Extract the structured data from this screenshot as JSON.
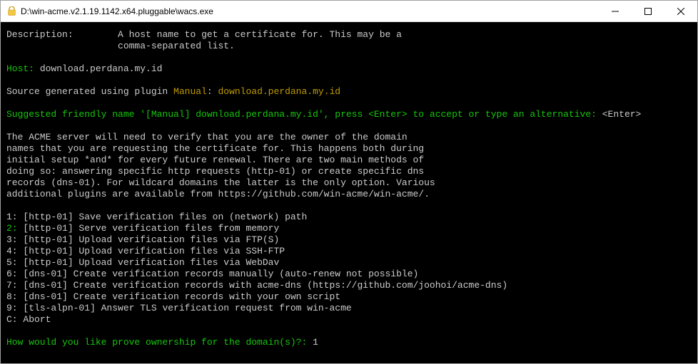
{
  "window": {
    "title": "D:\\win-acme.v2.1.19.1142.x64.pluggable\\wacs.exe"
  },
  "description": {
    "label": "Description:",
    "text_line1": "A host name to get a certificate for. This may be a",
    "text_line2": "comma-separated list."
  },
  "host": {
    "label": "Host:",
    "input": "download.perdana.my.id"
  },
  "source_line": {
    "prefix": "Source generated using plugin ",
    "plugin": "Manual",
    "colon": ": ",
    "value": "download.perdana.my.id"
  },
  "friendly_name": {
    "text": "Suggested friendly name '[Manual] download.perdana.my.id', press <Enter> to accept or type an alternative: ",
    "input": "<Enter>"
  },
  "info_block": {
    "l1": "The ACME server will need to verify that you are the owner of the domain",
    "l2": "names that you are requesting the certificate for. This happens both during",
    "l3": "initial setup *and* for every future renewal. There are two main methods of",
    "l4": "doing so: answering specific http requests (http-01) or create specific dns",
    "l5": "records (dns-01). For wildcard domains the latter is the only option. Various",
    "l6": "additional plugins are available from https://github.com/win-acme/win-acme/."
  },
  "menu": {
    "i1": {
      "num": "1:",
      "text": " [http-01] Save verification files on (network) path"
    },
    "i2": {
      "num": "2:",
      "text": " [http-01] Serve verification files from memory"
    },
    "i3": {
      "num": "3:",
      "text": " [http-01] Upload verification files via FTP(S)"
    },
    "i4": {
      "num": "4:",
      "text": " [http-01] Upload verification files via SSH-FTP"
    },
    "i5": {
      "num": "5:",
      "text": " [http-01] Upload verification files via WebDav"
    },
    "i6": {
      "num": "6:",
      "text": " [dns-01] Create verification records manually (auto-renew not possible)"
    },
    "i7": {
      "num": "7:",
      "text": " [dns-01] Create verification records with acme-dns (https://github.com/joohoi/acme-dns)"
    },
    "i8": {
      "num": "8:",
      "text": " [dns-01] Create verification records with your own script"
    },
    "i9": {
      "num": "9:",
      "text": " [tls-alpn-01] Answer TLS verification request from win-acme"
    },
    "iC": {
      "num": "C:",
      "text": " Abort"
    }
  },
  "prompt": {
    "text": "How would you like prove ownership for the domain(s)?: ",
    "input": "1"
  }
}
